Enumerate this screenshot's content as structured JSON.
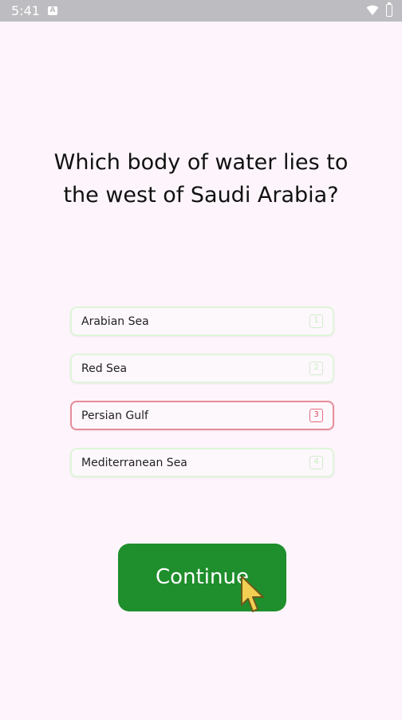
{
  "status_bar": {
    "time": "5:41",
    "notification_glyph": "A"
  },
  "question": {
    "text": "Which body of water lies to the west of Saudi Arabia?"
  },
  "options": [
    {
      "label": "Arabian Sea",
      "key": "1",
      "selected": false
    },
    {
      "label": "Red Sea",
      "key": "2",
      "selected": false
    },
    {
      "label": "Persian Gulf",
      "key": "3",
      "selected": true
    },
    {
      "label": "Mediterranean Sea",
      "key": "4",
      "selected": false
    }
  ],
  "continue_button": {
    "label": "Continue"
  },
  "colors": {
    "accent_green": "#1f8e2c",
    "selected_border": "#e58c9a",
    "option_border": "#dff5d9",
    "background": "#fdf5fb"
  },
  "icons": [
    "wifi-icon",
    "battery-icon",
    "notification-icon",
    "mouse-cursor-icon"
  ]
}
